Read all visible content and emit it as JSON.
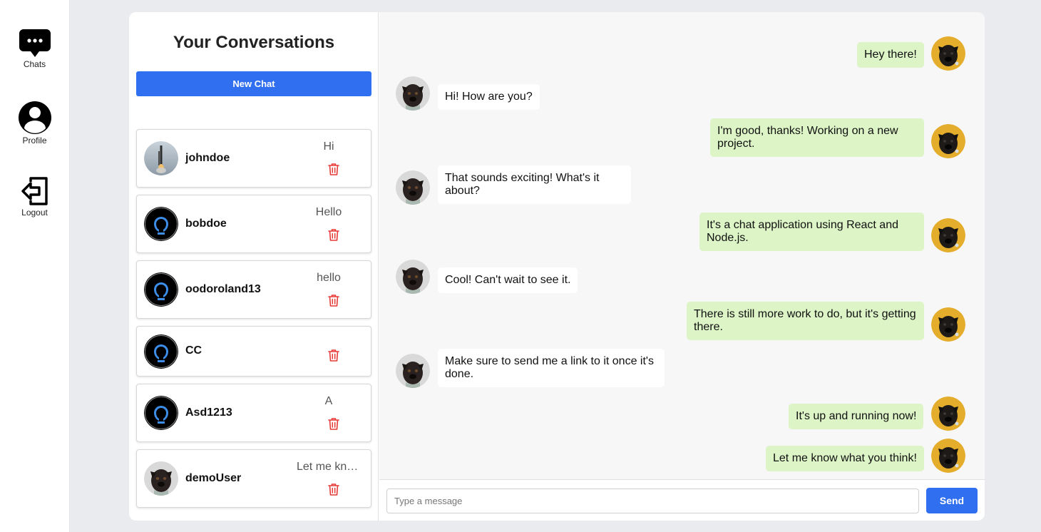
{
  "nav": {
    "chats_label": "Chats",
    "profile_label": "Profile",
    "logout_label": "Logout"
  },
  "conversations": {
    "title": "Your Conversations",
    "new_chat_label": "New Chat",
    "items": [
      {
        "name": "johndoe",
        "last": "Hi",
        "avatar": "rocket-launch-photo"
      },
      {
        "name": "bobdoe",
        "last": "Hello",
        "avatar": "default-user-avatar"
      },
      {
        "name": "oodoroland13",
        "last": "hello",
        "avatar": "default-user-avatar"
      },
      {
        "name": "CC",
        "last": "",
        "avatar": "default-user-avatar"
      },
      {
        "name": "Asd1213",
        "last": "A",
        "avatar": "default-user-avatar"
      },
      {
        "name": "demoUser",
        "last": "Let me know what you think!",
        "avatar": "pug-photo"
      }
    ]
  },
  "messages": [
    {
      "text": "Hey there!",
      "from": "me"
    },
    {
      "text": "Hi! How are you?",
      "from": "them"
    },
    {
      "text": "I'm good, thanks! Working on a new project.",
      "from": "me"
    },
    {
      "text": "That sounds exciting! What's it about?",
      "from": "them"
    },
    {
      "text": "It's a chat application using React and Node.js.",
      "from": "me"
    },
    {
      "text": "Cool! Can't wait to see it.",
      "from": "them"
    },
    {
      "text": "There is still more work to do, but it's getting there.",
      "from": "me"
    },
    {
      "text": "Make sure to send me a link to it once it's done.",
      "from": "them"
    },
    {
      "text": "It's up and running now!",
      "from": "me"
    },
    {
      "text": "Let me know what you think!",
      "from": "me"
    }
  ],
  "composer": {
    "placeholder": "Type a message",
    "value": "",
    "send_label": "Send"
  },
  "colors": {
    "accent": "#2f6ff0",
    "outgoing_bubble": "#dcf4c6",
    "incoming_bubble": "#ffffff",
    "delete_icon": "#e53935",
    "default_avatar": "#3d8ee8"
  }
}
